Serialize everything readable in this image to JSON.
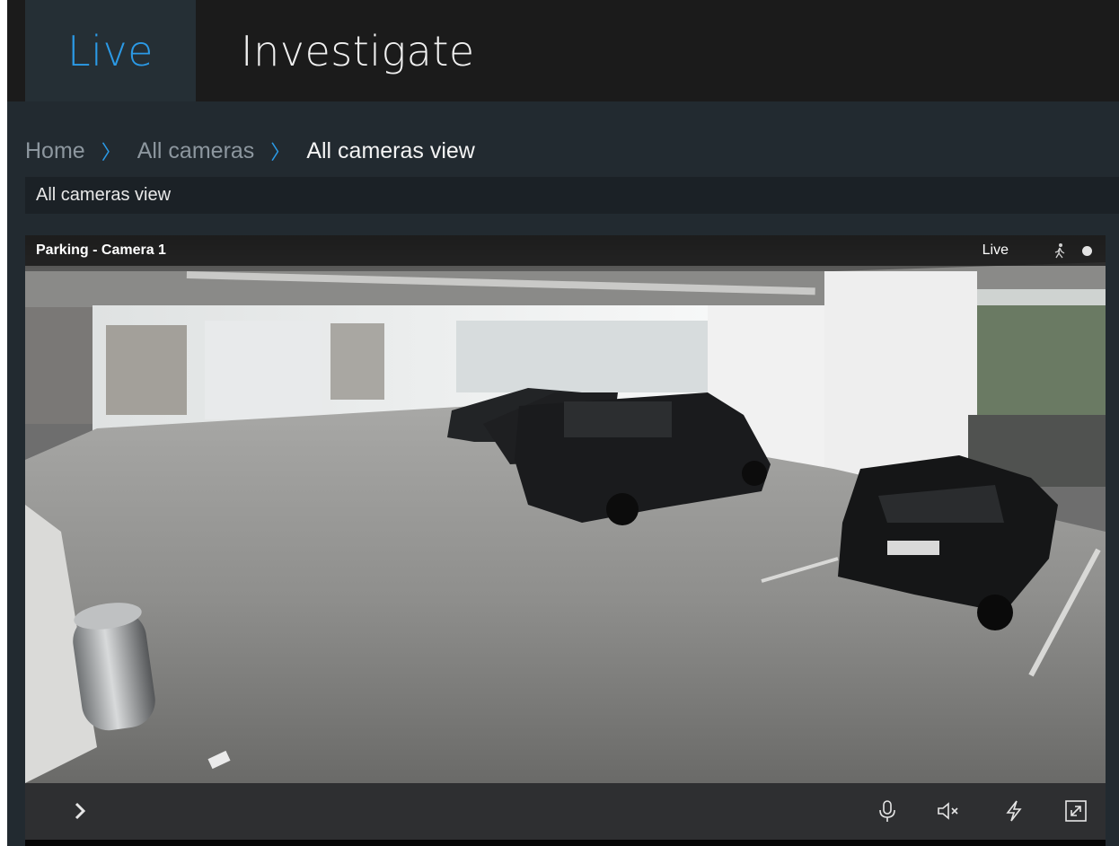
{
  "tabs": {
    "live": "Live",
    "investigate": "Investigate"
  },
  "breadcrumb": {
    "home": "Home",
    "all_cameras": "All cameras",
    "current": "All cameras view"
  },
  "view": {
    "title": "All cameras view"
  },
  "camera": {
    "name": "Parking - Camera 1",
    "status": "Live",
    "status_icons": [
      "motion-icon",
      "recording-dot-icon"
    ],
    "controls": [
      "expand-chevron-icon",
      "microphone-icon",
      "speaker-muted-icon",
      "lightning-icon",
      "fullscreen-icon"
    ]
  },
  "colors": {
    "accent": "#2b9ae6",
    "topbar": "#1b1b1b",
    "page_bg": "#222a30"
  }
}
